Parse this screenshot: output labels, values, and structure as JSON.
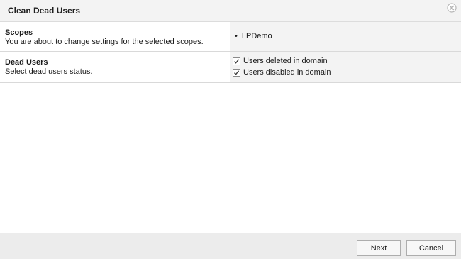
{
  "dialog": {
    "title": "Clean Dead Users",
    "close_icon": "close-circle-icon"
  },
  "rows": {
    "scopes": {
      "title": "Scopes",
      "description": "You are about to change settings for the selected scopes.",
      "items": [
        "LPDemo"
      ]
    },
    "dead_users": {
      "title": "Dead Users",
      "description": "Select dead users status.",
      "options": [
        {
          "label": "Users deleted in domain",
          "checked": true
        },
        {
          "label": "Users disabled in domain",
          "checked": true
        }
      ]
    }
  },
  "footer": {
    "next_label": "Next",
    "cancel_label": "Cancel"
  },
  "colors": {
    "titlebar_bg": "#f3f3f3",
    "right_panel_bg": "#f3f3f3",
    "footer_bg": "#ececec",
    "border": "#d9d9d9"
  }
}
